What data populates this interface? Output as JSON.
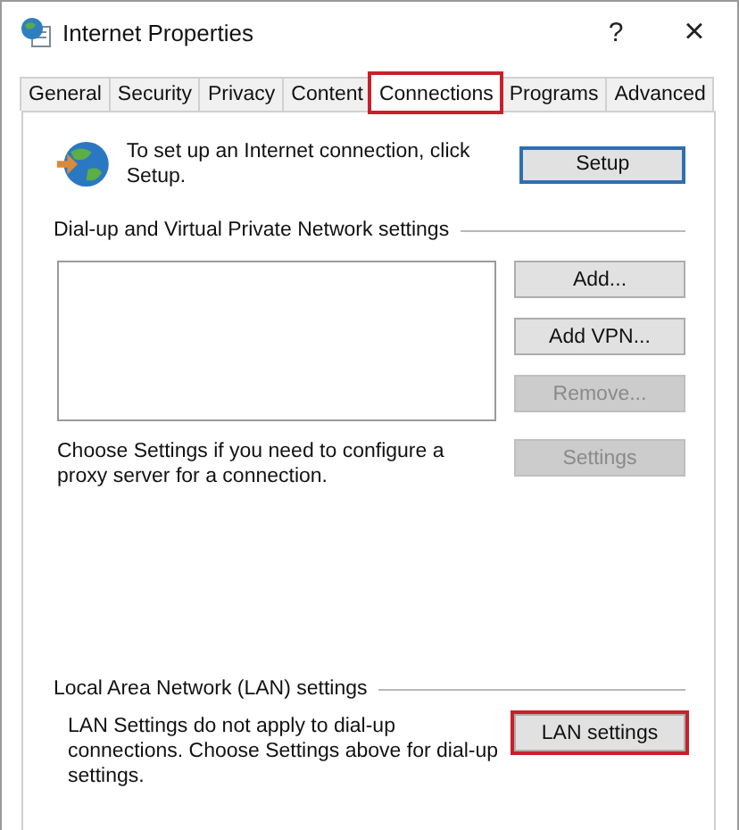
{
  "window": {
    "title": "Internet Properties",
    "help": "?",
    "close": "×"
  },
  "tabs": [
    {
      "label": "General",
      "selected": false,
      "highlighted": false
    },
    {
      "label": "Security",
      "selected": false,
      "highlighted": false
    },
    {
      "label": "Privacy",
      "selected": false,
      "highlighted": false
    },
    {
      "label": "Content",
      "selected": false,
      "highlighted": false
    },
    {
      "label": "Connections",
      "selected": true,
      "highlighted": true
    },
    {
      "label": "Programs",
      "selected": false,
      "highlighted": false
    },
    {
      "label": "Advanced",
      "selected": false,
      "highlighted": false
    }
  ],
  "setup": {
    "text": "To set up an Internet connection, click Setup.",
    "button": {
      "label": "Setup",
      "disabled": false,
      "highlighted": false
    }
  },
  "dialup": {
    "heading": "Dial-up and Virtual Private Network settings",
    "buttons": [
      {
        "label": "Add...",
        "disabled": false
      },
      {
        "label": "Add VPN...",
        "disabled": false
      },
      {
        "label": "Remove...",
        "disabled": true
      }
    ],
    "proxy_text": "Choose Settings if you need to configure a proxy server for a connection.",
    "settings_button": {
      "label": "Settings",
      "disabled": true
    }
  },
  "lan": {
    "heading": "Local Area Network (LAN) settings",
    "text": "LAN Settings do not apply to dial-up connections. Choose Settings above for dial-up settings.",
    "button": {
      "label": "LAN settings",
      "disabled": false,
      "highlighted": true
    }
  }
}
